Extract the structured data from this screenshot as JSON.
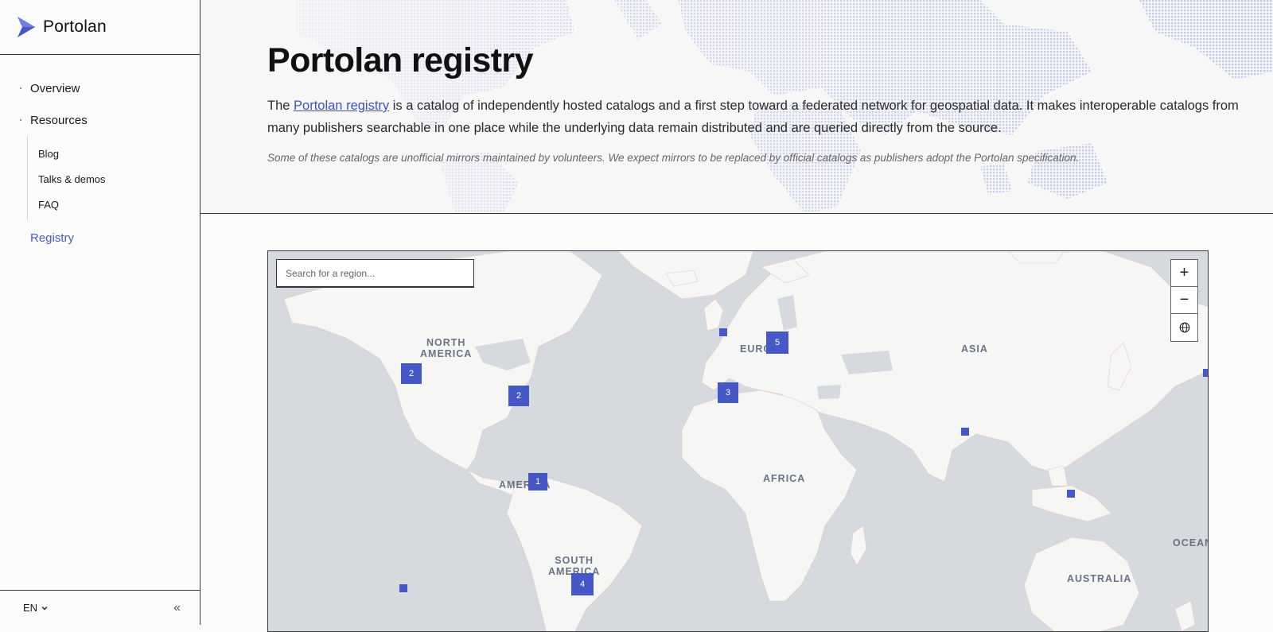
{
  "brand": {
    "name": "Portolan"
  },
  "nav": {
    "overview": "Overview",
    "resources": "Resources",
    "sub": [
      "Blog",
      "Talks & demos",
      "FAQ"
    ],
    "registry": "Registry"
  },
  "footer": {
    "language": "EN",
    "collapse": "«"
  },
  "header": {
    "title": "Portolan registry",
    "intro_prefix": "The ",
    "intro_link": "Portolan registry",
    "intro_suffix": " is a catalog of independently hosted catalogs and a first step toward a federated network for geospatial data. It makes interoperable catalogs from many publishers searchable in one place while the underlying data remain distributed and are queried directly from the source.",
    "note": "Some of these catalogs are unofficial mirrors maintained by volunteers. We expect mirrors to be replaced by official catalogs as publishers adopt the Portolan specification."
  },
  "map": {
    "search_placeholder": "Search for a region...",
    "controls": {
      "zoom_in": "+",
      "zoom_out": "−"
    },
    "regions": {
      "north_america": "NORTH\nAMERICA",
      "europe": "EUROPE",
      "asia": "ASIA",
      "africa": "AFRICA",
      "south_america": "SOUTH\nAMERICA",
      "central_america": "AMERICA",
      "australia": "AUSTRALIA",
      "oceania": "OCEANIA"
    },
    "clusters": {
      "us_west": "2",
      "us_east": "2",
      "central_america": "1",
      "iberia": "3",
      "europe": "5",
      "south_america": "4"
    },
    "accent": "#4657c7"
  }
}
